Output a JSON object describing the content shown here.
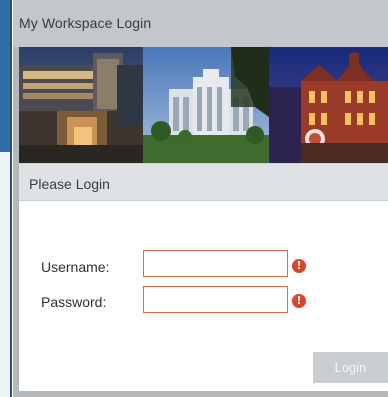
{
  "window": {
    "title": "My Workspace Login"
  },
  "banner": {
    "images": [
      "modern-building-at-night",
      "government-building-daytime",
      "historic-brick-building-dusk"
    ]
  },
  "login": {
    "section_title": "Please Login",
    "username_label": "Username:",
    "username_value": "",
    "password_label": "Password:",
    "password_value": "",
    "error_icon_glyph": "!",
    "submit_label": "Login"
  },
  "colors": {
    "error": "#d9442b",
    "input_border_error": "#e06a4a",
    "button_disabled": "#c9ccd0"
  }
}
